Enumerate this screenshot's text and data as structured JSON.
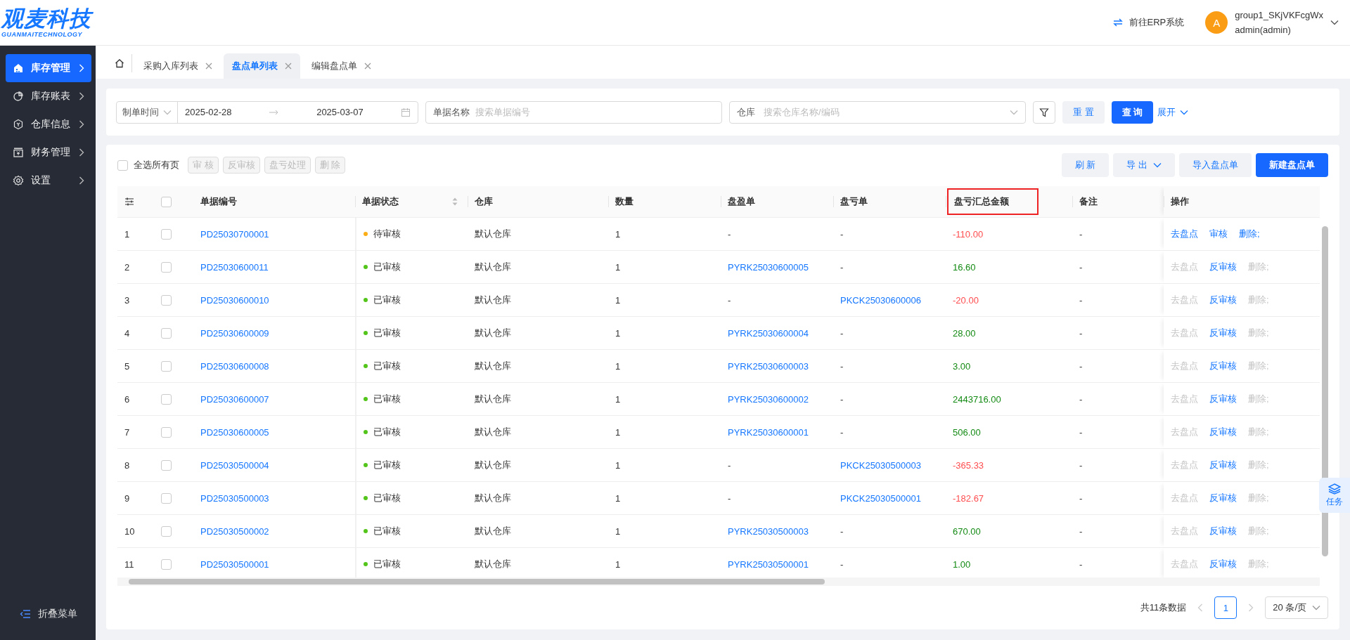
{
  "header": {
    "logo": "观麦科技",
    "logo_subtitle": "GUANMAITECHNOLOGY",
    "erp_link": "前往ERP系统",
    "avatar_letter": "A",
    "user_name": "group1_SKjVKFcgWx",
    "user_role": "admin(admin)"
  },
  "sidebar": {
    "items": [
      {
        "label": "库存管理",
        "selected": true
      },
      {
        "label": "库存账表",
        "selected": false
      },
      {
        "label": "仓库信息",
        "selected": false
      },
      {
        "label": "财务管理",
        "selected": false
      },
      {
        "label": "设置",
        "selected": false
      }
    ],
    "collapse_label": "折叠菜单"
  },
  "tabs": [
    {
      "label": "采购入库列表",
      "selected": false
    },
    {
      "label": "盘点单列表",
      "selected": true
    },
    {
      "label": "编辑盘点单",
      "selected": false
    }
  ],
  "filters": {
    "date_type": "制单时间",
    "date_start": "2025-02-28",
    "date_end": "2025-03-07",
    "name_label": "单据名称",
    "name_placeholder": "搜索单据编号",
    "warehouse_label": "仓库",
    "warehouse_placeholder": "搜索仓库名称/编码",
    "reset": "重 置",
    "query": "查 询",
    "expand": "展开"
  },
  "toolbar": {
    "select_all": {
      "label": "全选所有页",
      "checked": false
    },
    "batch_actions": [
      {
        "label": "审 核",
        "disabled": true
      },
      {
        "label": "反审核",
        "disabled": true
      },
      {
        "label": "盘亏处理",
        "disabled": true
      },
      {
        "label": "删 除",
        "disabled": true
      }
    ],
    "actions": [
      {
        "label": "刷 新",
        "kind": "plain"
      },
      {
        "label": "导 出",
        "kind": "dropdown"
      },
      {
        "label": "导入盘点单",
        "kind": "plain"
      },
      {
        "label": "新建盘点单",
        "kind": "primary"
      }
    ]
  },
  "table": {
    "all_rows_checked": false,
    "columns": [
      {
        "label": "单据编号",
        "highlighted": false
      },
      {
        "label": "单据状态",
        "sortable": true,
        "highlighted": false
      },
      {
        "label": "仓库",
        "highlighted": false
      },
      {
        "label": "数量",
        "highlighted": false
      },
      {
        "label": "盘盈单",
        "highlighted": false
      },
      {
        "label": "盘亏单",
        "highlighted": false
      },
      {
        "label": "盘亏汇总金额",
        "highlighted": true
      },
      {
        "label": "备注",
        "highlighted": false
      },
      {
        "label": "操作",
        "highlighted": false
      }
    ],
    "rows": [
      {
        "index": "1",
        "checked": false,
        "number": "PD25030700001",
        "status": {
          "text": "待审核",
          "color": "#faad14"
        },
        "warehouse": "默认仓库",
        "quantity": "1",
        "gain_order": {
          "text": "-",
          "link": false
        },
        "loss_order": {
          "text": "-",
          "link": false
        },
        "amount": {
          "text": "-110.00",
          "color": "#ff4d4f"
        },
        "remark": "-",
        "actions": [
          {
            "label": "去盘点",
            "disabled": false
          },
          {
            "label": "审核",
            "disabled": false
          },
          {
            "label": "删除;",
            "disabled": false
          }
        ]
      },
      {
        "index": "2",
        "checked": false,
        "number": "PD25030600011",
        "status": {
          "text": "已审核",
          "color": "#52c41a"
        },
        "warehouse": "默认仓库",
        "quantity": "1",
        "gain_order": {
          "text": "PYRK25030600005",
          "link": true
        },
        "loss_order": {
          "text": "-",
          "link": false
        },
        "amount": {
          "text": "16.60",
          "color": "#138a13"
        },
        "remark": "-",
        "actions": [
          {
            "label": "去盘点",
            "disabled": true
          },
          {
            "label": "反审核",
            "disabled": false
          },
          {
            "label": "删除;",
            "disabled": true
          }
        ]
      },
      {
        "index": "3",
        "checked": false,
        "number": "PD25030600010",
        "status": {
          "text": "已审核",
          "color": "#52c41a"
        },
        "warehouse": "默认仓库",
        "quantity": "1",
        "gain_order": {
          "text": "-",
          "link": false
        },
        "loss_order": {
          "text": "PKCK25030600006",
          "link": true
        },
        "amount": {
          "text": "-20.00",
          "color": "#ff4d4f"
        },
        "remark": "-",
        "actions": [
          {
            "label": "去盘点",
            "disabled": true
          },
          {
            "label": "反审核",
            "disabled": false
          },
          {
            "label": "删除;",
            "disabled": true
          }
        ]
      },
      {
        "index": "4",
        "checked": false,
        "number": "PD25030600009",
        "status": {
          "text": "已审核",
          "color": "#52c41a"
        },
        "warehouse": "默认仓库",
        "quantity": "1",
        "gain_order": {
          "text": "PYRK25030600004",
          "link": true
        },
        "loss_order": {
          "text": "-",
          "link": false
        },
        "amount": {
          "text": "28.00",
          "color": "#138a13"
        },
        "remark": "-",
        "actions": [
          {
            "label": "去盘点",
            "disabled": true
          },
          {
            "label": "反审核",
            "disabled": false
          },
          {
            "label": "删除;",
            "disabled": true
          }
        ]
      },
      {
        "index": "5",
        "checked": false,
        "number": "PD25030600008",
        "status": {
          "text": "已审核",
          "color": "#52c41a"
        },
        "warehouse": "默认仓库",
        "quantity": "1",
        "gain_order": {
          "text": "PYRK25030600003",
          "link": true
        },
        "loss_order": {
          "text": "-",
          "link": false
        },
        "amount": {
          "text": "3.00",
          "color": "#138a13"
        },
        "remark": "-",
        "actions": [
          {
            "label": "去盘点",
            "disabled": true
          },
          {
            "label": "反审核",
            "disabled": false
          },
          {
            "label": "删除;",
            "disabled": true
          }
        ]
      },
      {
        "index": "6",
        "checked": false,
        "number": "PD25030600007",
        "status": {
          "text": "已审核",
          "color": "#52c41a"
        },
        "warehouse": "默认仓库",
        "quantity": "1",
        "gain_order": {
          "text": "PYRK25030600002",
          "link": true
        },
        "loss_order": {
          "text": "-",
          "link": false
        },
        "amount": {
          "text": "2443716.00",
          "color": "#138a13"
        },
        "remark": "-",
        "actions": [
          {
            "label": "去盘点",
            "disabled": true
          },
          {
            "label": "反审核",
            "disabled": false
          },
          {
            "label": "删除;",
            "disabled": true
          }
        ]
      },
      {
        "index": "7",
        "checked": false,
        "number": "PD25030600005",
        "status": {
          "text": "已审核",
          "color": "#52c41a"
        },
        "warehouse": "默认仓库",
        "quantity": "1",
        "gain_order": {
          "text": "PYRK25030600001",
          "link": true
        },
        "loss_order": {
          "text": "-",
          "link": false
        },
        "amount": {
          "text": "506.00",
          "color": "#138a13"
        },
        "remark": "-",
        "actions": [
          {
            "label": "去盘点",
            "disabled": true
          },
          {
            "label": "反审核",
            "disabled": false
          },
          {
            "label": "删除;",
            "disabled": true
          }
        ]
      },
      {
        "index": "8",
        "checked": false,
        "number": "PD25030500004",
        "status": {
          "text": "已审核",
          "color": "#52c41a"
        },
        "warehouse": "默认仓库",
        "quantity": "1",
        "gain_order": {
          "text": "-",
          "link": false
        },
        "loss_order": {
          "text": "PKCK25030500003",
          "link": true
        },
        "amount": {
          "text": "-365.33",
          "color": "#ff4d4f"
        },
        "remark": "-",
        "actions": [
          {
            "label": "去盘点",
            "disabled": true
          },
          {
            "label": "反审核",
            "disabled": false
          },
          {
            "label": "删除;",
            "disabled": true
          }
        ]
      },
      {
        "index": "9",
        "checked": false,
        "number": "PD25030500003",
        "status": {
          "text": "已审核",
          "color": "#52c41a"
        },
        "warehouse": "默认仓库",
        "quantity": "1",
        "gain_order": {
          "text": "-",
          "link": false
        },
        "loss_order": {
          "text": "PKCK25030500001",
          "link": true
        },
        "amount": {
          "text": "-182.67",
          "color": "#ff4d4f"
        },
        "remark": "-",
        "actions": [
          {
            "label": "去盘点",
            "disabled": true
          },
          {
            "label": "反审核",
            "disabled": false
          },
          {
            "label": "删除;",
            "disabled": true
          }
        ]
      },
      {
        "index": "10",
        "checked": false,
        "number": "PD25030500002",
        "status": {
          "text": "已审核",
          "color": "#52c41a"
        },
        "warehouse": "默认仓库",
        "quantity": "1",
        "gain_order": {
          "text": "PYRK25030500003",
          "link": true
        },
        "loss_order": {
          "text": "-",
          "link": false
        },
        "amount": {
          "text": "670.00",
          "color": "#138a13"
        },
        "remark": "-",
        "actions": [
          {
            "label": "去盘点",
            "disabled": true
          },
          {
            "label": "反审核",
            "disabled": false
          },
          {
            "label": "删除;",
            "disabled": true
          }
        ]
      },
      {
        "index": "11",
        "checked": false,
        "number": "PD25030500001",
        "status": {
          "text": "已审核",
          "color": "#52c41a"
        },
        "warehouse": "默认仓库",
        "quantity": "1",
        "gain_order": {
          "text": "PYRK25030500001",
          "link": true
        },
        "loss_order": {
          "text": "-",
          "link": false
        },
        "amount": {
          "text": "1.00",
          "color": "#138a13"
        },
        "remark": "-",
        "actions": [
          {
            "label": "去盘点",
            "disabled": true
          },
          {
            "label": "反审核",
            "disabled": false
          },
          {
            "label": "删除;",
            "disabled": true
          }
        ]
      }
    ]
  },
  "pagination": {
    "total": "共11条数据",
    "pages": [
      {
        "label": "1",
        "selected": true
      }
    ],
    "page_size": "20 条/页"
  },
  "task_button": "任务"
}
